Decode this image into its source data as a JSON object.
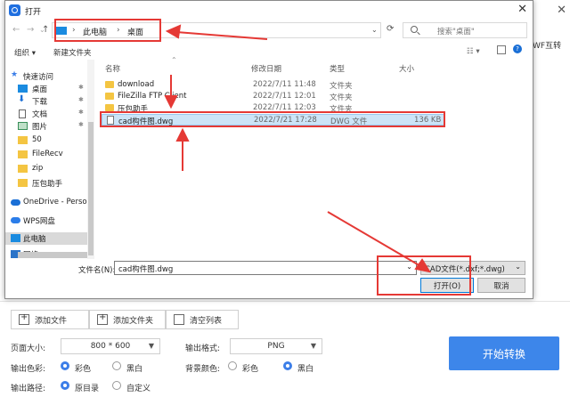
{
  "background_app": {
    "close_glyph": "✕",
    "partial_text": "WF互转",
    "add_file": "添加文件",
    "add_folder": "添加文件夹",
    "clear_list": "清空列表",
    "page_size_label": "页面大小:",
    "page_size_value": "800 * 600",
    "output_format_label": "输出格式:",
    "output_format_value": "PNG",
    "output_color_label": "输出色彩:",
    "color_option": "彩色",
    "bw_option": "黑白",
    "bg_color_label": "背景颜色:",
    "bg_color_option": "彩色",
    "bg_bw_option": "黑白",
    "output_path_label": "输出路径:",
    "original_dir": "原目录",
    "custom": "自定义",
    "start_button": "开始转换"
  },
  "dialog": {
    "title": "打开",
    "close_glyph": "✕",
    "address": {
      "root": "此电脑",
      "current": "桌面"
    },
    "search_placeholder": "搜索\"桌面\"",
    "toolbar": {
      "organize": "组织 ▾",
      "new_folder": "新建文件夹"
    },
    "nav": [
      {
        "label": "快速访问",
        "icon": "star-icon"
      },
      {
        "label": "桌面",
        "icon": "desktop-icon"
      },
      {
        "label": "下载",
        "icon": "download-icon"
      },
      {
        "label": "文档",
        "icon": "document-icon"
      },
      {
        "label": "图片",
        "icon": "picture-icon"
      },
      {
        "label": "50",
        "icon": "folder-icon"
      },
      {
        "label": "FileRecv",
        "icon": "folder-icon"
      },
      {
        "label": "zip",
        "icon": "folder-icon"
      },
      {
        "label": "压包助手",
        "icon": "folder-icon"
      },
      {
        "label": "OneDrive - Perso",
        "icon": "cloud-icon"
      },
      {
        "label": "WPS网盘",
        "icon": "cloud-icon"
      },
      {
        "label": "此电脑",
        "icon": "computer-icon"
      },
      {
        "label": "网络",
        "icon": "network-icon"
      }
    ],
    "columns": {
      "name": "名称",
      "date": "修改日期",
      "type": "类型",
      "size": "大小"
    },
    "files": [
      {
        "name": "download",
        "date": "2022/7/11 11:48",
        "type": "文件夹",
        "size": ""
      },
      {
        "name": "FileZilla FTP Client",
        "date": "2022/7/11 12:01",
        "type": "文件夹",
        "size": ""
      },
      {
        "name": "压包助手",
        "date": "2022/7/11 12:03",
        "type": "文件夹",
        "size": ""
      },
      {
        "name": "cad构件图.dwg",
        "date": "2022/7/21 17:28",
        "type": "DWG 文件",
        "size": "136 KB"
      }
    ],
    "filename_label": "文件名(N):",
    "filename_value": "cad构件图.dwg",
    "filetype_value": "CAD文件(*.dxf;*.dwg)",
    "open_button": "打开(O)",
    "cancel_button": "取消"
  },
  "colors": {
    "accent": "#3d86ea",
    "annotation": "#e53935",
    "selection": "#cce4f7"
  }
}
